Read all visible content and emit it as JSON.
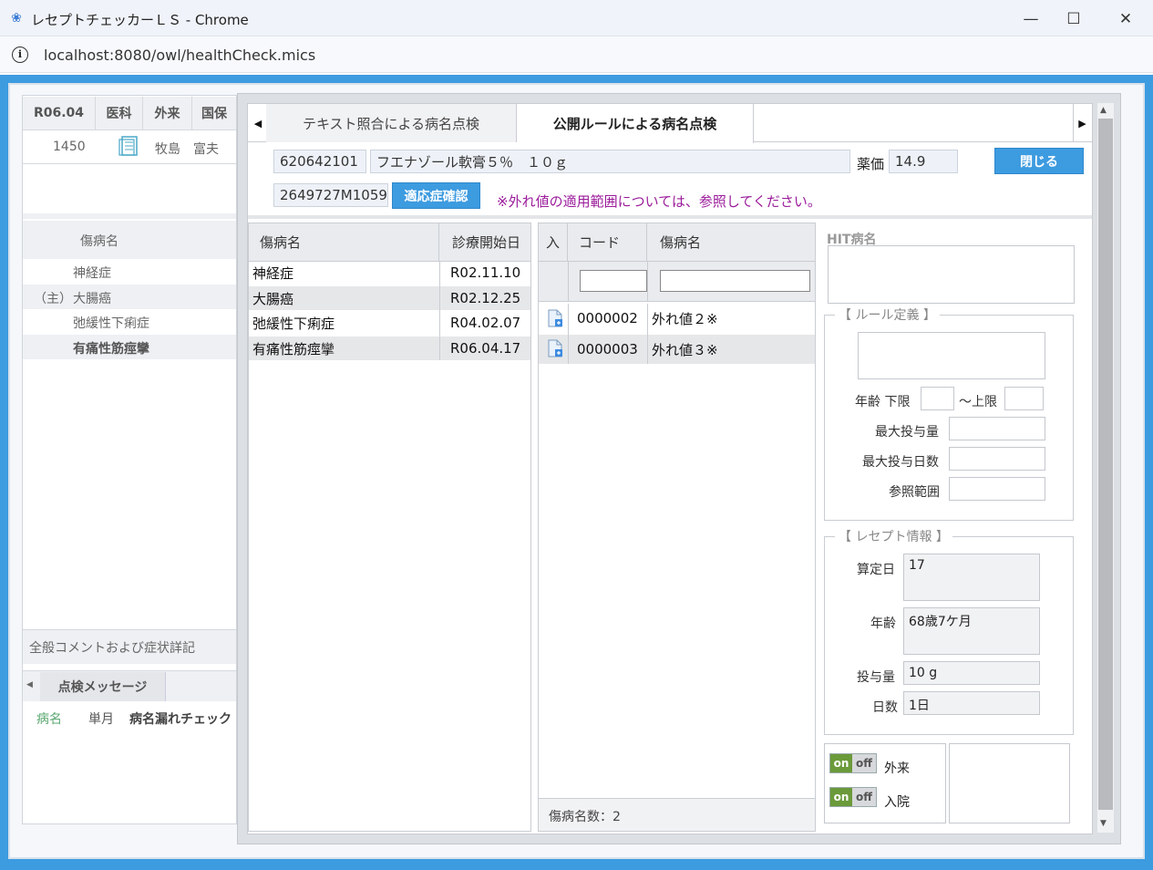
{
  "window": {
    "title": "レセプトチェッカーＬＳ - Chrome",
    "url": "localhost:8080/owl/healthCheck.mics",
    "minimize": "—",
    "maximize": "☐",
    "close": "✕"
  },
  "left": {
    "header": [
      "R06.04",
      "医科",
      "外来",
      "国保"
    ],
    "patient_no": "1450",
    "patient_name": "牧島　富夫",
    "disease_col": "傷病名",
    "diseases": [
      {
        "prefix": "",
        "name": "神経症"
      },
      {
        "prefix": "（主）",
        "name": "大腸癌"
      },
      {
        "prefix": "",
        "name": "弛緩性下痢症"
      },
      {
        "prefix": "",
        "name": "有痛性筋痙攣"
      }
    ],
    "comment": "全般コメントおよび症状詳記",
    "msg_tab": "点検メッセージ",
    "msg_row": [
      "病名",
      "単月",
      "病名漏れチェック"
    ]
  },
  "tabs": {
    "text_check": "テキスト照合による病名点検",
    "rule_check": "公開ルールによる病名点検",
    "left_arrow": "◀",
    "right_arrow": "▶"
  },
  "drug": {
    "code": "620642101",
    "name": "フエナゾール軟膏５％　１０ｇ",
    "price_label": "薬価",
    "price": "14.9",
    "close_btn": "閉じる",
    "code2": "2649727M1059",
    "confirm_btn": "適応症確認",
    "note": "※外れ値の適用範囲については、参照してください。"
  },
  "disease_table": {
    "col_name": "傷病名",
    "col_date": "診療開始日",
    "rows": [
      {
        "name": "神経症",
        "date": "R02.11.10"
      },
      {
        "name": "大腸癌",
        "date": "R02.12.25"
      },
      {
        "name": "弛緩性下痢症",
        "date": "R04.02.07"
      },
      {
        "name": "有痛性筋痙攣",
        "date": "R06.04.17"
      }
    ]
  },
  "code_table": {
    "col_in": "入",
    "col_code": "コード",
    "col_name": "傷病名",
    "rows": [
      {
        "code": "0000002",
        "name": "外れ値２※"
      },
      {
        "code": "0000003",
        "name": "外れ値３※"
      }
    ],
    "footer": "傷病名数：2"
  },
  "right": {
    "hit_label": "HIT病名",
    "rule_legend": "【 ルール定義 】",
    "age_label": "年齢 下限",
    "age_upper": "～上限",
    "max_dose": "最大投与量",
    "max_days": "最大投与日数",
    "ref_range": "参照範囲",
    "receipt_legend": "【 レセプト情報 】",
    "calc_day_label": "算定日",
    "calc_day": "17",
    "age2_label": "年齢",
    "age2": "68歳7ケ月",
    "dose_label": "投与量",
    "dose": "10 g",
    "days_label": "日数",
    "days": "1日",
    "on": "on",
    "off": "off",
    "outpatient": "外来",
    "inpatient": "入院"
  },
  "scroll": {
    "up": "▲",
    "down": "▼"
  }
}
